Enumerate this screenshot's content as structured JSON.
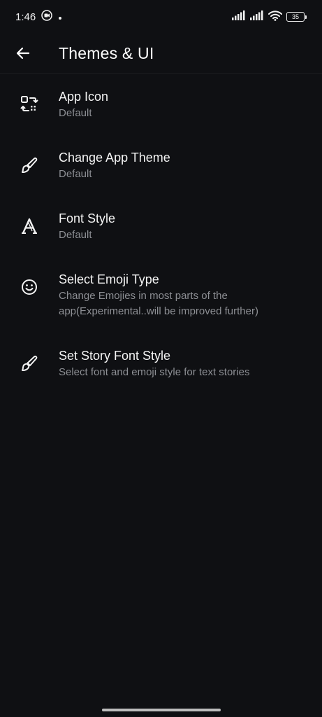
{
  "status_bar": {
    "time": "1:46",
    "battery_level": "35"
  },
  "header": {
    "title": "Themes & UI"
  },
  "settings": [
    {
      "id": "app-icon",
      "title": "App Icon",
      "subtitle": "Default",
      "icon": "app-icon-swap-icon"
    },
    {
      "id": "change-app-theme",
      "title": "Change App Theme",
      "subtitle": "Default",
      "icon": "brush-icon"
    },
    {
      "id": "font-style",
      "title": "Font Style",
      "subtitle": "Default",
      "icon": "font-icon"
    },
    {
      "id": "select-emoji-type",
      "title": "Select Emoji Type",
      "subtitle": "Change Emojies in most parts of the app(Experimental..will be improved further)",
      "icon": "smiley-icon"
    },
    {
      "id": "set-story-font-style",
      "title": "Set Story Font Style",
      "subtitle": "Select font and emoji style for text stories",
      "icon": "brush-icon"
    }
  ],
  "colors": {
    "background": "#0f1013",
    "title_text": "#f4f4f4",
    "subtitle_text": "#8d8f94"
  }
}
